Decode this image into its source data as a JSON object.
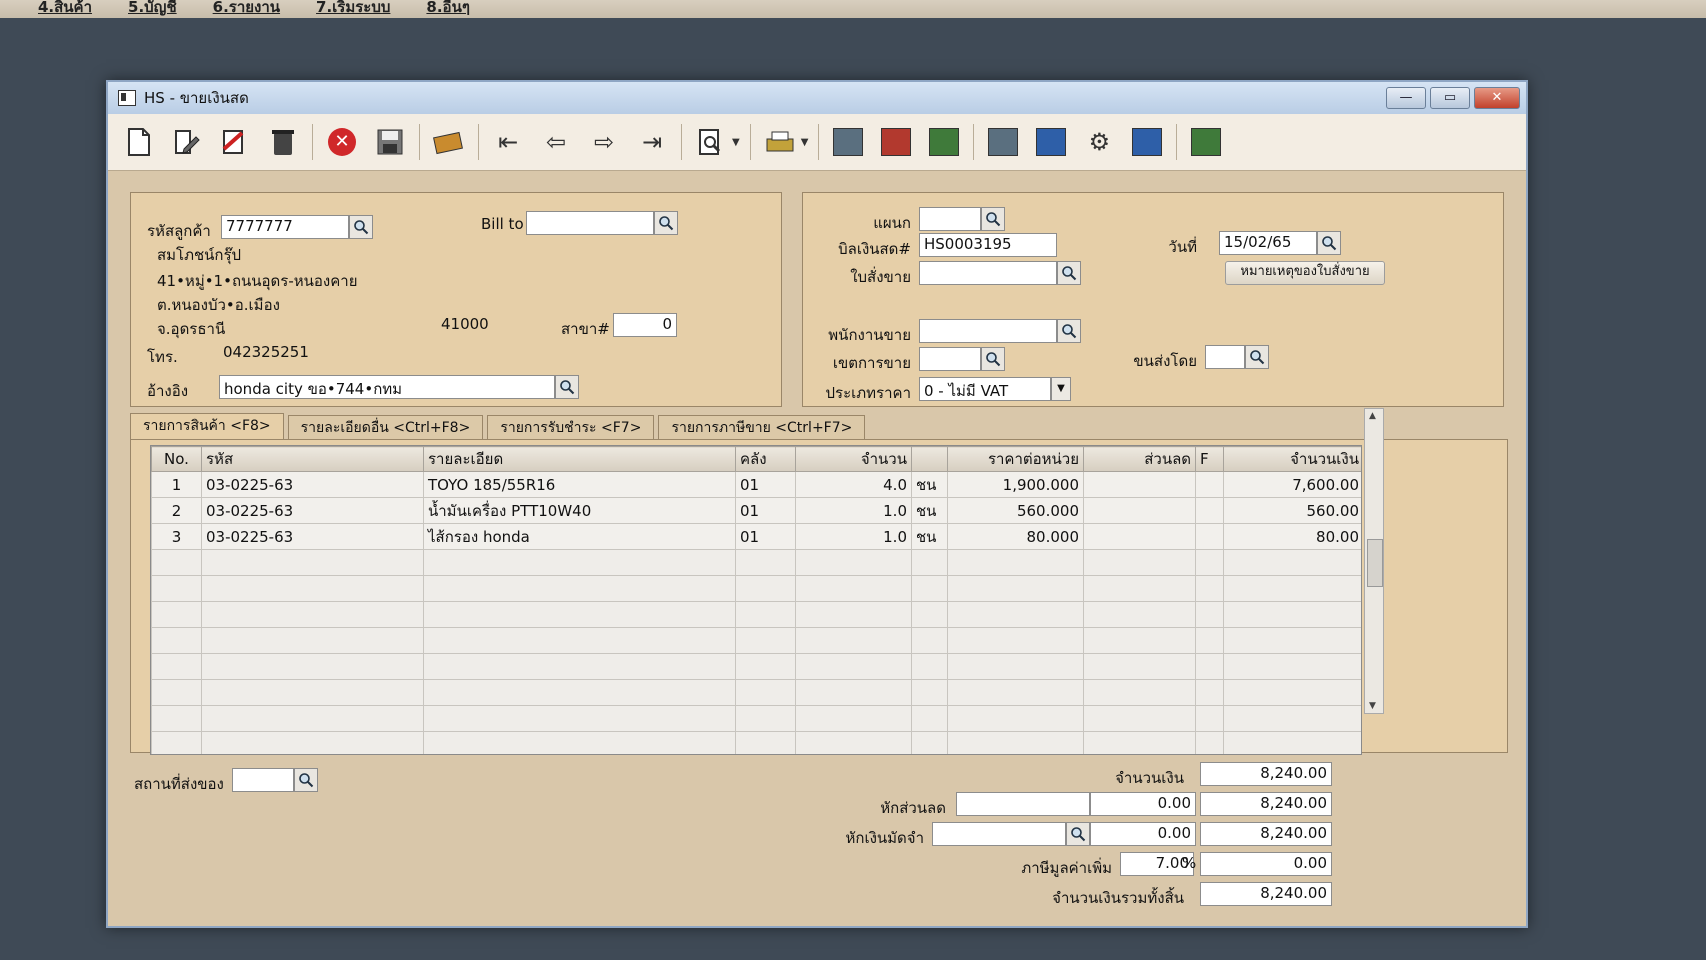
{
  "menubar": [
    "4.สินค้า",
    "5.บัญชี",
    "6.รายงาน",
    "7.เริ่มระบบ",
    "8.อื่นๆ"
  ],
  "window": {
    "title": "HS - ขายเงินสด",
    "minimize": "—",
    "maximize": "▭",
    "close": "✕"
  },
  "customer": {
    "code_label": "รหัสลูกค้า",
    "code": "7777777",
    "name": "สมโภชน์กรุ๊ป",
    "address1": "41•หมู่•1•ถนนอุดร-หนองคาย",
    "address2": "ต.หนองบัว•อ.เมือง",
    "province": "จ.อุดรธานี",
    "postcode": "41000",
    "branch_label": "สาขา#",
    "branch": "0",
    "phone_label": "โทร.",
    "phone": "042325251",
    "ref_label": "อ้างอิง",
    "ref": "honda city ขอ•744•กทม",
    "billto_label": "Bill to",
    "billto": ""
  },
  "doc": {
    "dept_label": "แผนก",
    "dept": "",
    "bill_label": "บิลเงินสด#",
    "bill": "HS0003195",
    "date_label": "วันที่",
    "date": "15/02/65",
    "so_label": "ใบสั่งขาย",
    "so": "",
    "so_note_button": "หมายเหตุของใบสั่งขาย",
    "salesman_label": "พนักงานขาย",
    "salesman": "",
    "area_label": "เขตการขาย",
    "area": "",
    "shipby_label": "ขนส่งโดย",
    "shipby": "",
    "pricetype_label": "ประเภทราคา",
    "pricetype": "0 - ไม่มี VAT"
  },
  "tabs": [
    "รายการสินค้า <F8>",
    "รายละเอียดอื่น <Ctrl+F8>",
    "รายการรับชำระ <F7>",
    "รายการภาษีขาย <Ctrl+F7>"
  ],
  "grid": {
    "columns": [
      "No.",
      "รหัส",
      "รายละเอียด",
      "คลัง",
      "จำนวน",
      "",
      "ราคาต่อหน่วย",
      "ส่วนลด",
      "F",
      "จำนวนเงิน"
    ],
    "rows": [
      [
        "1",
        "03-0225-63",
        "TOYO 185/55R16",
        "01",
        "4.0",
        "ชน",
        "1,900.000",
        "",
        "",
        "7,600.00"
      ],
      [
        "2",
        "03-0225-63",
        "น้ำมันเครื่อง PTT10W40",
        "01",
        "1.0",
        "ชน",
        "560.000",
        "",
        "",
        "560.00"
      ],
      [
        "3",
        "03-0225-63",
        "ไส้กรอง honda",
        "01",
        "1.0",
        "ชน",
        "80.000",
        "",
        "",
        "80.00"
      ]
    ]
  },
  "footer": {
    "shipto_label": "สถานที่ส่งของ",
    "shipto": "",
    "amount_label": "จำนวนเงิน",
    "amount": "8,240.00",
    "discount_label": "หักส่วนลด",
    "discount_text": "",
    "discount_value": "0.00",
    "after_discount": "8,240.00",
    "deposit_label": "หักเงินมัดจำ",
    "deposit_text": "",
    "deposit_value": "0.00",
    "after_deposit": "8,240.00",
    "vat_label": "ภาษีมูลค่าเพิ่ม",
    "vat_rate": "7.00",
    "vat_pct": "%",
    "vat_amount": "0.00",
    "total_label": "จำนวนเงินรวมทั้งสิ้น",
    "total": "8,240.00"
  }
}
